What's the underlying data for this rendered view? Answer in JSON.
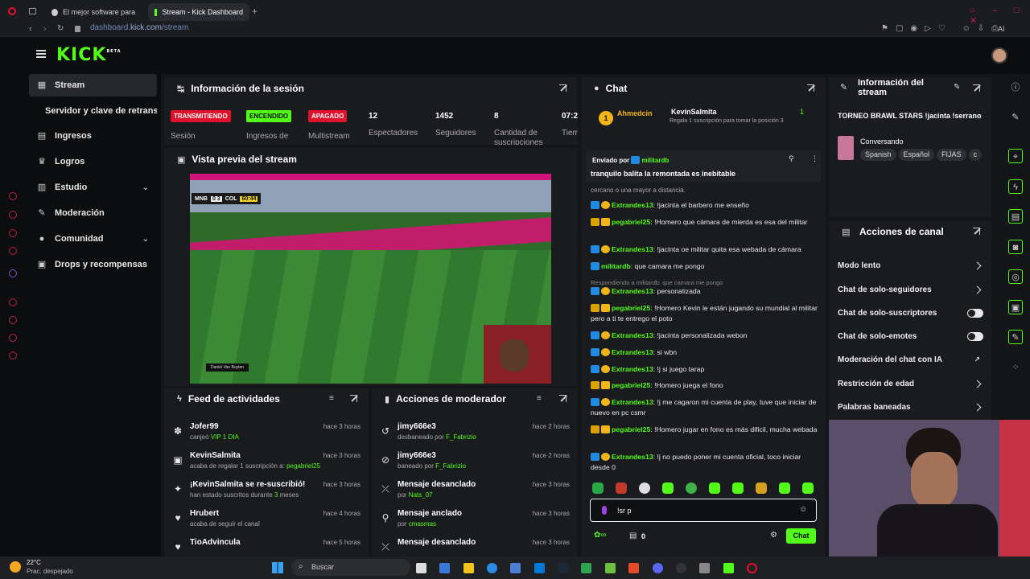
{
  "browser": {
    "tabs": [
      {
        "label": "El mejor software para pu"
      },
      {
        "label": "Stream - Kick Dashboard"
      }
    ],
    "url_base": "dashboard.",
    "url_host": "kick.com",
    "url_path": "/stream",
    "ai_label": "AI"
  },
  "app": {
    "logo": "KICK",
    "logo_sup": "BETA"
  },
  "sidebar": {
    "items": [
      {
        "label": "Stream"
      },
      {
        "label": "Servidor y clave de retransmisión"
      },
      {
        "label": "Ingresos"
      },
      {
        "label": "Logros"
      },
      {
        "label": "Estudio"
      },
      {
        "label": "Moderación"
      },
      {
        "label": "Comunidad"
      },
      {
        "label": "Drops y recompensas"
      }
    ]
  },
  "session": {
    "title": "Información de la sesión",
    "badges": [
      {
        "label": "TRANSMITIENDO",
        "color": "#e0112b"
      },
      {
        "label": "ENCENDIDO",
        "color": "#53fc18"
      },
      {
        "label": "APAGADO",
        "color": "#e0112b"
      }
    ],
    "stats": [
      {
        "value": "12",
        "label": "Espectadores"
      },
      {
        "value": "1452",
        "label": "Seguidores"
      },
      {
        "value": "8",
        "label": "Cantidad de suscripciones"
      },
      {
        "value": "07:2",
        "label": "Tiem"
      }
    ],
    "labels": [
      "Sesión",
      "Ingresos de",
      "Multistream"
    ]
  },
  "preview": {
    "title": "Vista previa del stream",
    "score_home": "MNB",
    "score": "0 3",
    "score_away": "COL",
    "clock": "60:44",
    "player": "Daniel Van Buyten"
  },
  "activity": {
    "title": "Feed de actividades",
    "items": [
      {
        "name": "Jofer99",
        "desc_pre": "canjeó ",
        "desc_hl": "VIP 1 DIA",
        "desc_post": "",
        "time": "hace 3 horas"
      },
      {
        "name": "KevinSalmita",
        "desc_pre": "acaba de regalar 1 suscripción a: ",
        "desc_hl": "pegabriel25",
        "desc_post": "",
        "time": "hace 3 horas"
      },
      {
        "name": "¡KevinSalmita se re-suscribió!",
        "desc_pre": "han estado suscritos durante ",
        "desc_hl": "3",
        "desc_post": " meses",
        "time": "hace 3 horas"
      },
      {
        "name": "Hrubert",
        "desc_pre": "acaba de seguir el canal",
        "desc_hl": "",
        "desc_post": "",
        "time": "hace 4 horas"
      },
      {
        "name": "TioAdvincula",
        "desc_pre": "",
        "desc_hl": "",
        "desc_post": "",
        "time": "hace 5 horas"
      }
    ]
  },
  "modactions": {
    "title": "Acciones de moderador",
    "items": [
      {
        "name": "jimy666e3",
        "desc_pre": "desbaneado por ",
        "desc_hl": "F_Fabrizio",
        "time": "hace 2 horas"
      },
      {
        "name": "jimy666e3",
        "desc_pre": "baneado por ",
        "desc_hl": "F_Fabrizio",
        "time": "hace 2 horas"
      },
      {
        "name": "Mensaje desanclado",
        "desc_pre": "por ",
        "desc_hl": "Nats_07",
        "time": "hace 3 horas"
      },
      {
        "name": "Mensaje anclado",
        "desc_pre": "por ",
        "desc_hl": "cmasmas",
        "time": "hace 3 horas"
      },
      {
        "name": "Mensaje desanclado",
        "desc_pre": "",
        "desc_hl": "",
        "time": "hace 3 horas"
      }
    ]
  },
  "chat": {
    "title": "Chat",
    "gift_top": {
      "user1": "Ahmedcin",
      "rank1": "1",
      "user2": "KevinSalmita",
      "text": "Regala 1 suscripción para tomar la posición 3",
      "count": "1"
    },
    "pinned": {
      "by_label": "Enviado por",
      "by_user": "militardb",
      "text": "tranquilo balita la remontada es inebitable"
    },
    "partial": "cercano o una mayor a distancia.",
    "messages": [
      {
        "user": "Extrandes13",
        "text": ": !jacinta el barbero me enseño",
        "badge": "b"
      },
      {
        "user": "pegabriel25",
        "text": ": !Homero que cámara de mierda es esa del militar",
        "badge": "c"
      },
      {
        "user": "Extrandes13",
        "text": ": !jacinta oe militar quita esa webada de cámara",
        "badge": "b"
      },
      {
        "user": "militardb",
        "text": ": que camara me pongo",
        "badge": "b"
      },
      {
        "reply": "Respondiendo a militardb: que camara me pongo",
        "user": "Extrandes13",
        "text": ": personalizada",
        "badge": "b"
      },
      {
        "user": "pegabriel25",
        "text": ": !Homero Kevin le están jugando su mundial al militar pero a ti te entrego el poto",
        "badge": "c"
      },
      {
        "user": "Extrandes13",
        "text": ": !jacinta personalizada webon",
        "badge": "b"
      },
      {
        "user": "Extrandes13",
        "text": ": si wbn",
        "badge": "b"
      },
      {
        "user": "Extrandes13",
        "text": ": !j si juego tarap",
        "badge": "b"
      },
      {
        "user": "pegabriel25",
        "text": ": !Homero juega el fono",
        "badge": "c"
      },
      {
        "user": "Extrandes13",
        "text": ": !j me cagaron mi cuenta de play, tuve que iniciar de nuevo en pc csmr",
        "badge": "b"
      },
      {
        "user": "pegabriel25",
        "text": ": !Homero jugar en fono es más dificil, mucha webada",
        "badge": "c"
      },
      {
        "user": "Extrandes13",
        "text": ": !j no puedo poner mi cuenta oficial, toco iniciar desde 0",
        "badge": "b"
      }
    ],
    "input_value": "!sr p",
    "points": "0",
    "send_label": "Chat"
  },
  "stream_info": {
    "title": "Información del stream",
    "stream_title": "TORNEO BRAWL STARS !jacinta !serrano",
    "category": "Conversando",
    "tags": [
      "Spanish",
      "Español",
      "FIJAS",
      "c"
    ]
  },
  "channel_actions": {
    "title": "Acciones de canal",
    "items": [
      {
        "label": "Modo lento",
        "control": "arrow"
      },
      {
        "label": "Chat de solo-seguidores",
        "control": "arrow"
      },
      {
        "label": "Chat de solo-suscriptores",
        "control": "toggle"
      },
      {
        "label": "Chat de solo-emotes",
        "control": "toggle"
      },
      {
        "label": "Moderación del chat con IA",
        "control": "link"
      },
      {
        "label": "Restricción de edad",
        "control": "arrow"
      },
      {
        "label": "Palabras baneadas",
        "control": "arrow"
      }
    ]
  },
  "taskbar": {
    "temp": "22°C",
    "weather": "Prac. despejado",
    "search": "Buscar"
  },
  "colors": {
    "accent": "#53fc18",
    "live": "#e0112b",
    "bg": "#141517",
    "panel": "#1a1b1e"
  }
}
